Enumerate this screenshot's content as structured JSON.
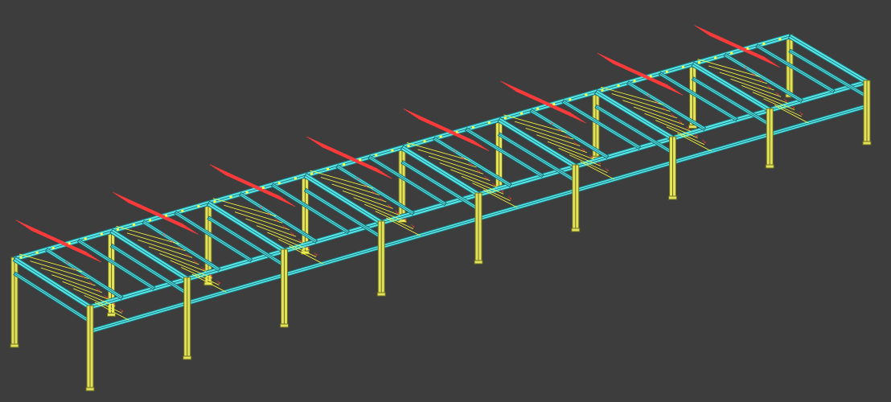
{
  "viewport": {
    "background": "#3d3d3d",
    "name": "3d-model-viewport"
  },
  "model": {
    "bays": 8,
    "colors": {
      "beam": "#56e6e6",
      "beam_edge": "#1b6f75",
      "column": "#e2e25a",
      "column_edge": "#6d6d1f",
      "load_red": "#ff3b3b",
      "load_yellow": "#ffff3c"
    },
    "icons": {
      "column": "steel-column-icon",
      "beam": "steel-beam-icon",
      "load": "load-arrow-icon"
    }
  }
}
